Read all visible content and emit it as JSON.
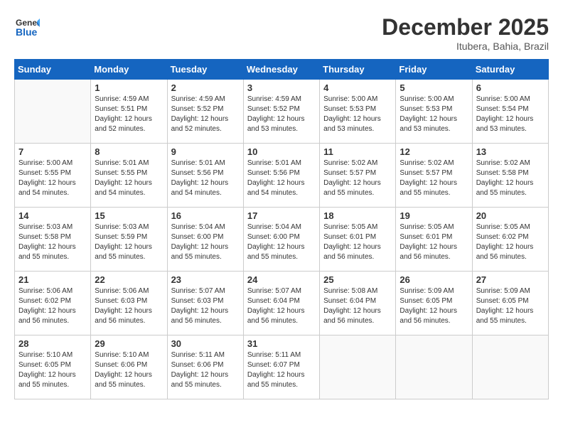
{
  "header": {
    "logo_line1": "General",
    "logo_line2": "Blue",
    "month_title": "December 2025",
    "location": "Itubera, Bahia, Brazil"
  },
  "days_of_week": [
    "Sunday",
    "Monday",
    "Tuesday",
    "Wednesday",
    "Thursday",
    "Friday",
    "Saturday"
  ],
  "weeks": [
    [
      {
        "day": "",
        "info": ""
      },
      {
        "day": "1",
        "info": "Sunrise: 4:59 AM\nSunset: 5:51 PM\nDaylight: 12 hours\nand 52 minutes."
      },
      {
        "day": "2",
        "info": "Sunrise: 4:59 AM\nSunset: 5:52 PM\nDaylight: 12 hours\nand 52 minutes."
      },
      {
        "day": "3",
        "info": "Sunrise: 4:59 AM\nSunset: 5:52 PM\nDaylight: 12 hours\nand 53 minutes."
      },
      {
        "day": "4",
        "info": "Sunrise: 5:00 AM\nSunset: 5:53 PM\nDaylight: 12 hours\nand 53 minutes."
      },
      {
        "day": "5",
        "info": "Sunrise: 5:00 AM\nSunset: 5:53 PM\nDaylight: 12 hours\nand 53 minutes."
      },
      {
        "day": "6",
        "info": "Sunrise: 5:00 AM\nSunset: 5:54 PM\nDaylight: 12 hours\nand 53 minutes."
      }
    ],
    [
      {
        "day": "7",
        "info": "Sunrise: 5:00 AM\nSunset: 5:55 PM\nDaylight: 12 hours\nand 54 minutes."
      },
      {
        "day": "8",
        "info": "Sunrise: 5:01 AM\nSunset: 5:55 PM\nDaylight: 12 hours\nand 54 minutes."
      },
      {
        "day": "9",
        "info": "Sunrise: 5:01 AM\nSunset: 5:56 PM\nDaylight: 12 hours\nand 54 minutes."
      },
      {
        "day": "10",
        "info": "Sunrise: 5:01 AM\nSunset: 5:56 PM\nDaylight: 12 hours\nand 54 minutes."
      },
      {
        "day": "11",
        "info": "Sunrise: 5:02 AM\nSunset: 5:57 PM\nDaylight: 12 hours\nand 55 minutes."
      },
      {
        "day": "12",
        "info": "Sunrise: 5:02 AM\nSunset: 5:57 PM\nDaylight: 12 hours\nand 55 minutes."
      },
      {
        "day": "13",
        "info": "Sunrise: 5:02 AM\nSunset: 5:58 PM\nDaylight: 12 hours\nand 55 minutes."
      }
    ],
    [
      {
        "day": "14",
        "info": "Sunrise: 5:03 AM\nSunset: 5:58 PM\nDaylight: 12 hours\nand 55 minutes."
      },
      {
        "day": "15",
        "info": "Sunrise: 5:03 AM\nSunset: 5:59 PM\nDaylight: 12 hours\nand 55 minutes."
      },
      {
        "day": "16",
        "info": "Sunrise: 5:04 AM\nSunset: 6:00 PM\nDaylight: 12 hours\nand 55 minutes."
      },
      {
        "day": "17",
        "info": "Sunrise: 5:04 AM\nSunset: 6:00 PM\nDaylight: 12 hours\nand 55 minutes."
      },
      {
        "day": "18",
        "info": "Sunrise: 5:05 AM\nSunset: 6:01 PM\nDaylight: 12 hours\nand 56 minutes."
      },
      {
        "day": "19",
        "info": "Sunrise: 5:05 AM\nSunset: 6:01 PM\nDaylight: 12 hours\nand 56 minutes."
      },
      {
        "day": "20",
        "info": "Sunrise: 5:05 AM\nSunset: 6:02 PM\nDaylight: 12 hours\nand 56 minutes."
      }
    ],
    [
      {
        "day": "21",
        "info": "Sunrise: 5:06 AM\nSunset: 6:02 PM\nDaylight: 12 hours\nand 56 minutes."
      },
      {
        "day": "22",
        "info": "Sunrise: 5:06 AM\nSunset: 6:03 PM\nDaylight: 12 hours\nand 56 minutes."
      },
      {
        "day": "23",
        "info": "Sunrise: 5:07 AM\nSunset: 6:03 PM\nDaylight: 12 hours\nand 56 minutes."
      },
      {
        "day": "24",
        "info": "Sunrise: 5:07 AM\nSunset: 6:04 PM\nDaylight: 12 hours\nand 56 minutes."
      },
      {
        "day": "25",
        "info": "Sunrise: 5:08 AM\nSunset: 6:04 PM\nDaylight: 12 hours\nand 56 minutes."
      },
      {
        "day": "26",
        "info": "Sunrise: 5:09 AM\nSunset: 6:05 PM\nDaylight: 12 hours\nand 56 minutes."
      },
      {
        "day": "27",
        "info": "Sunrise: 5:09 AM\nSunset: 6:05 PM\nDaylight: 12 hours\nand 55 minutes."
      }
    ],
    [
      {
        "day": "28",
        "info": "Sunrise: 5:10 AM\nSunset: 6:05 PM\nDaylight: 12 hours\nand 55 minutes."
      },
      {
        "day": "29",
        "info": "Sunrise: 5:10 AM\nSunset: 6:06 PM\nDaylight: 12 hours\nand 55 minutes."
      },
      {
        "day": "30",
        "info": "Sunrise: 5:11 AM\nSunset: 6:06 PM\nDaylight: 12 hours\nand 55 minutes."
      },
      {
        "day": "31",
        "info": "Sunrise: 5:11 AM\nSunset: 6:07 PM\nDaylight: 12 hours\nand 55 minutes."
      },
      {
        "day": "",
        "info": ""
      },
      {
        "day": "",
        "info": ""
      },
      {
        "day": "",
        "info": ""
      }
    ]
  ]
}
